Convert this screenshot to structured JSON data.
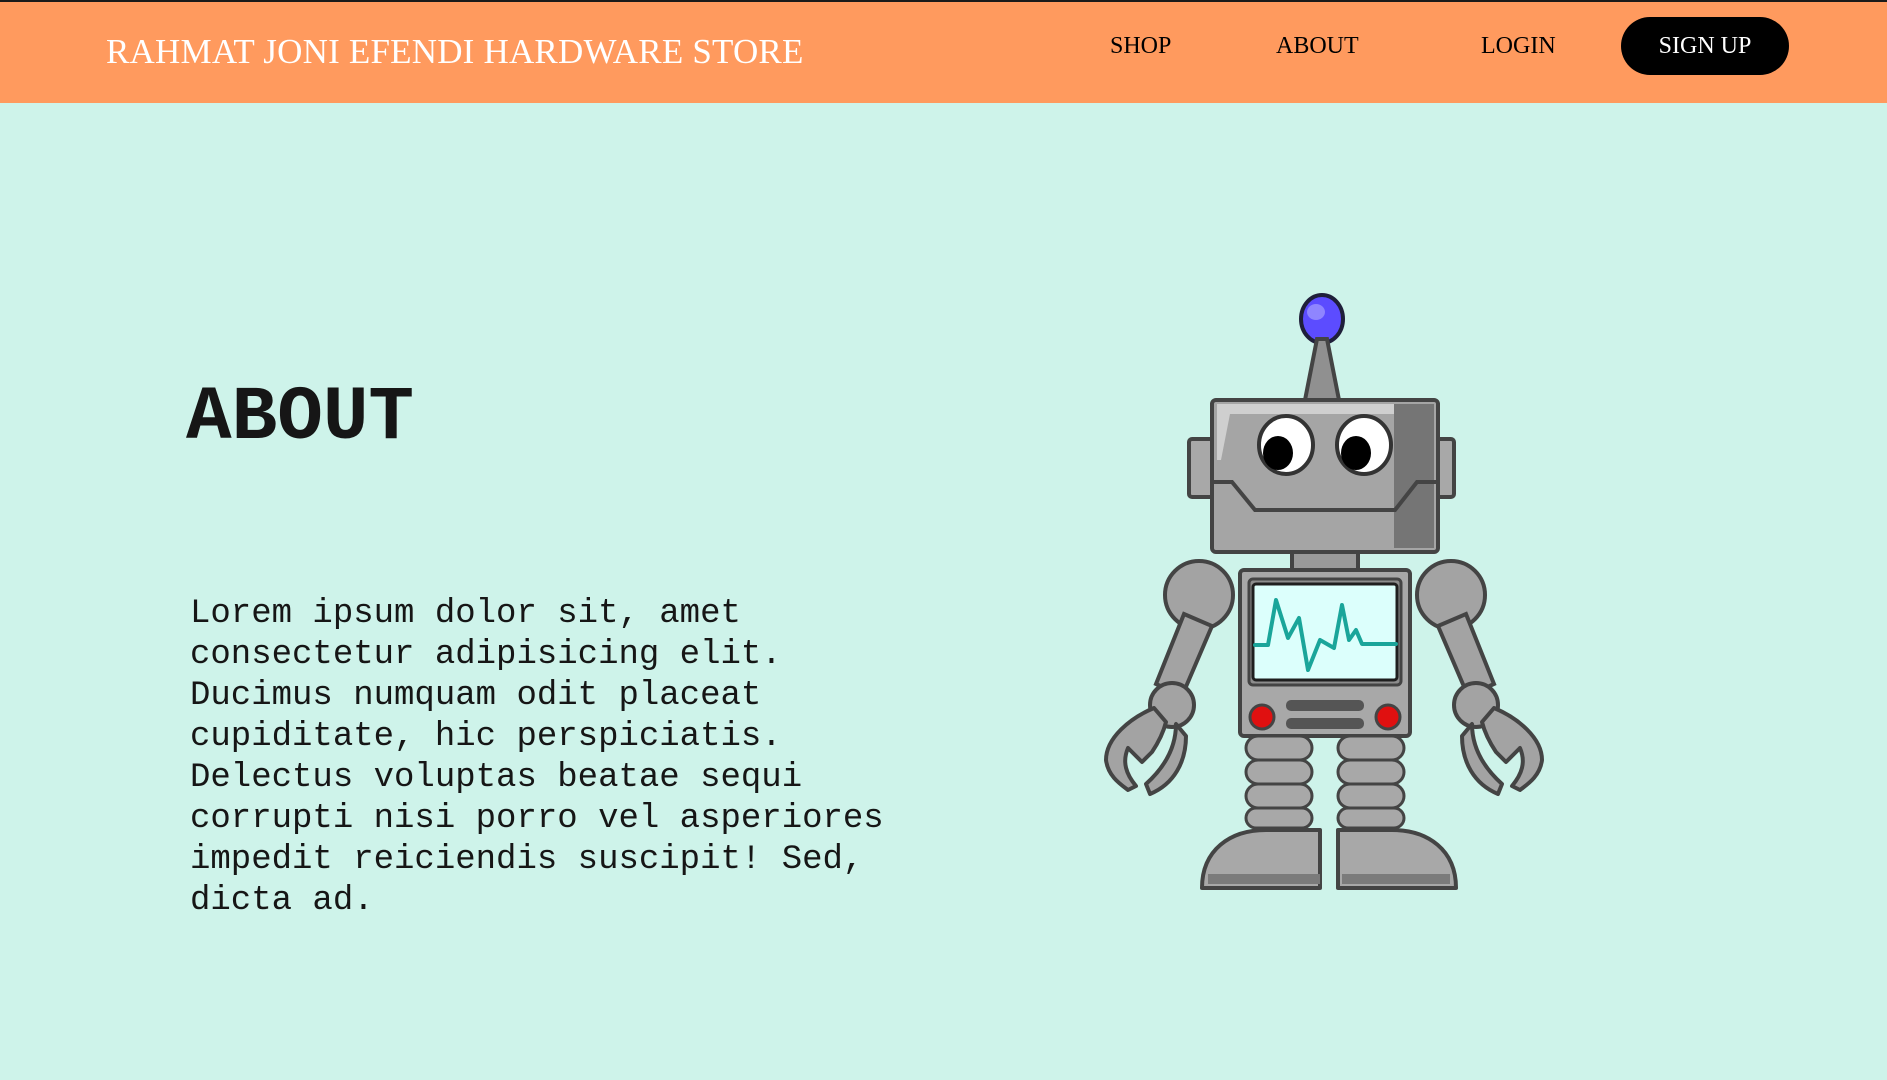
{
  "header": {
    "brand": "RAHMAT JONI EFENDI HARDWARE STORE",
    "nav": {
      "shop": "SHOP",
      "about": "ABOUT",
      "login": "LOGIN",
      "signup": "SIGN UP"
    }
  },
  "main": {
    "title": "ABOUT",
    "description": "Lorem ipsum dolor sit, amet consectetur adipisicing elit. Ducimus numquam odit placeat cupiditate, hic perspiciatis. Delectus voluptas beatae sequi corrupti nisi porro vel asperiores impedit reiciendis suscipit! Sed, dicta ad.",
    "illustration_icon": "robot-illustration-icon"
  },
  "colors": {
    "page_background": "#cef3ea",
    "navbar_background": "#ff9a5e",
    "signup_background": "#000000",
    "brand_text": "#ffffff",
    "robot_antenna_light": "#5c4cff",
    "robot_screen_line": "#1aa59a"
  }
}
